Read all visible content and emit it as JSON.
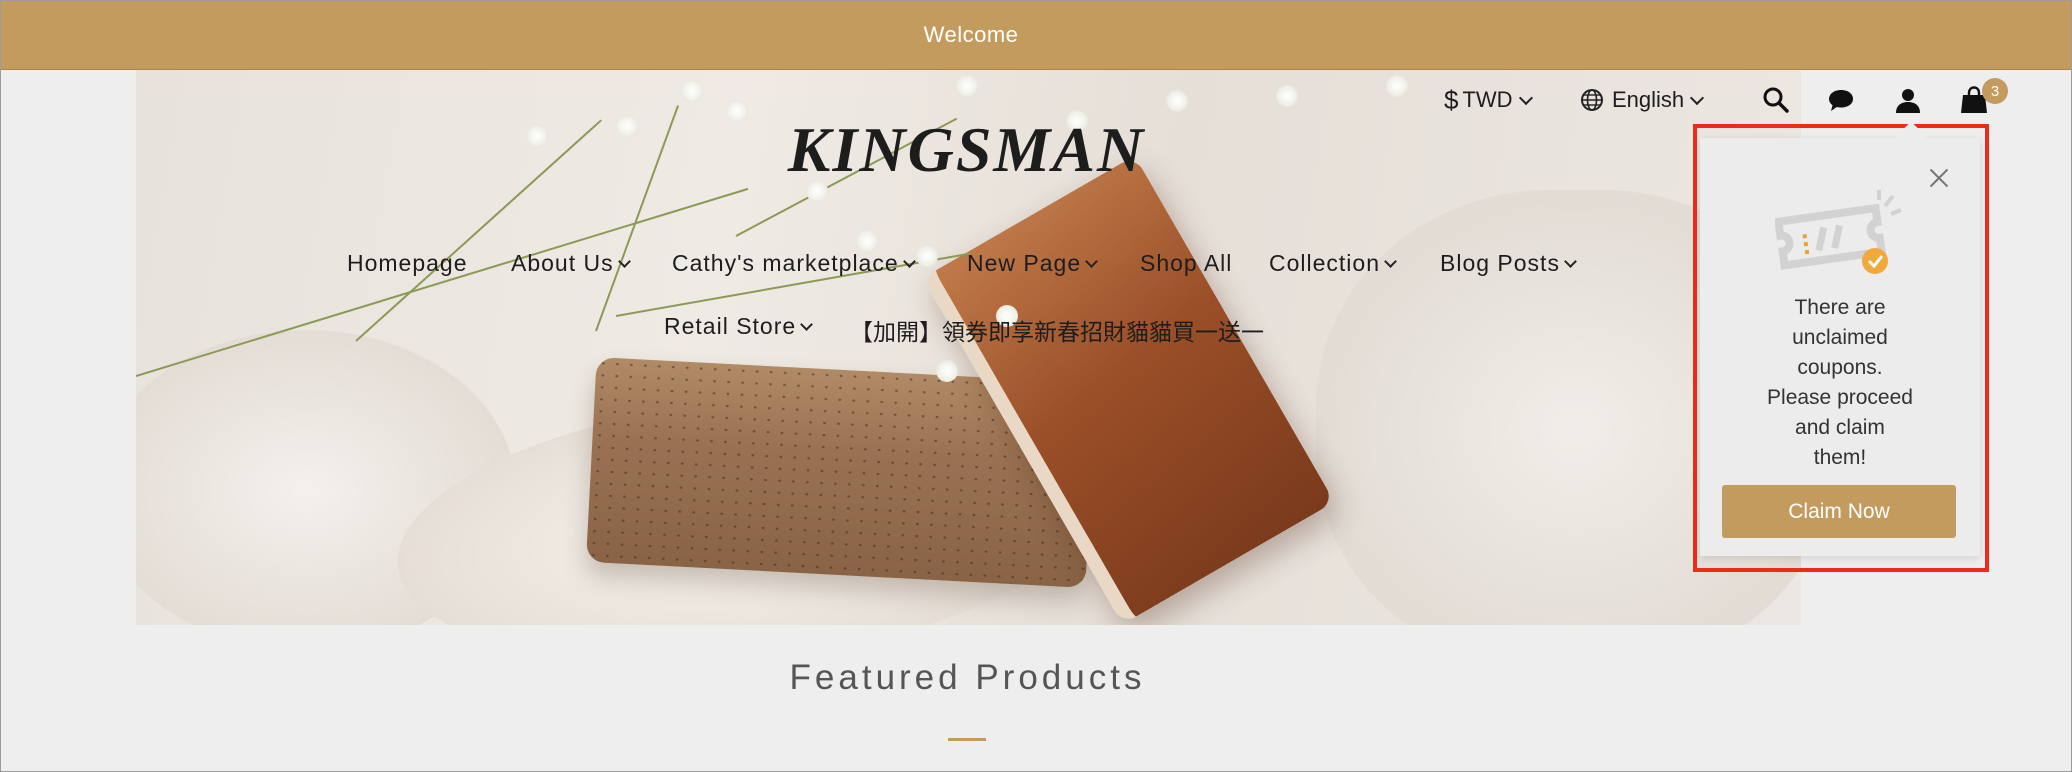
{
  "announcement": {
    "text": "Welcome",
    "bg_color": "#c39b5e"
  },
  "header": {
    "logo": "KINGSMAN",
    "currency": {
      "symbol": "$",
      "label": "TWD"
    },
    "language": "English",
    "icons": [
      "search-icon",
      "chat-icon",
      "account-icon",
      "cart-icon"
    ],
    "cart_count": "3"
  },
  "nav": {
    "items": [
      {
        "label": "Homepage",
        "has_dropdown": false
      },
      {
        "label": "About Us",
        "has_dropdown": true
      },
      {
        "label": "Cathy's marketplace",
        "has_dropdown": true
      },
      {
        "label": "New Page",
        "has_dropdown": true
      },
      {
        "label": "Shop All",
        "has_dropdown": false
      },
      {
        "label": "Collection",
        "has_dropdown": true
      },
      {
        "label": "Blog Posts",
        "has_dropdown": true
      },
      {
        "label": "Retail Store",
        "has_dropdown": true
      },
      {
        "label": "【加開】領券即享新春招財貓貓買一送一",
        "has_dropdown": false
      }
    ]
  },
  "section": {
    "title": "Featured Products"
  },
  "coupon_popup": {
    "icon": "coupon-ticket-icon",
    "message_lines": [
      "There are",
      "unclaimed",
      "coupons.",
      "Please proceed",
      "and claim",
      "them!"
    ],
    "button_label": "Claim Now",
    "highlight_color": "#ee2b1b"
  },
  "colors": {
    "accent": "#c39b5e",
    "page_bg": "#eeeeee"
  }
}
